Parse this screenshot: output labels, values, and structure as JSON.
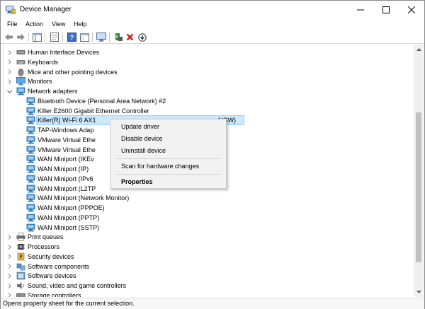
{
  "window": {
    "title": "Device Manager"
  },
  "menubar": {
    "items": [
      "File",
      "Action",
      "View",
      "Help"
    ]
  },
  "tree": {
    "items": [
      {
        "label": "Human Interface Devices",
        "icon": "hid-icon",
        "level": 1,
        "expander": "collapsed"
      },
      {
        "label": "Keyboards",
        "icon": "keyboard-icon",
        "level": 1,
        "expander": "collapsed"
      },
      {
        "label": "Mice and other pointing devices",
        "icon": "mouse-icon",
        "level": 1,
        "expander": "collapsed"
      },
      {
        "label": "Monitors",
        "icon": "monitor-icon",
        "level": 1,
        "expander": "collapsed"
      },
      {
        "label": "Network adapters",
        "icon": "network-adapter-icon",
        "level": 1,
        "expander": "expanded"
      },
      {
        "label": "Bluetooth Device (Personal Area Network) #2",
        "icon": "network-adapter-icon",
        "level": 2
      },
      {
        "label": "Killer E2600 Gigabit Ethernet Controller",
        "icon": "network-adapter-icon",
        "level": 2
      },
      {
        "label": "Killer(R) Wi-Fi 6 AX1",
        "icon": "network-adapter-icon",
        "level": 2,
        "selected": true,
        "suffix": "NGW)"
      },
      {
        "label": "TAP-Windows Adap",
        "icon": "network-adapter-icon",
        "level": 2
      },
      {
        "label": "VMware Virtual Ethe",
        "icon": "network-adapter-icon",
        "level": 2
      },
      {
        "label": "VMware Virtual Ethe",
        "icon": "network-adapter-icon",
        "level": 2
      },
      {
        "label": "WAN Miniport (IKEv",
        "icon": "network-adapter-icon",
        "level": 2
      },
      {
        "label": "WAN Miniport (IP)",
        "icon": "network-adapter-icon",
        "level": 2
      },
      {
        "label": "WAN Miniport (IPv6",
        "icon": "network-adapter-icon",
        "level": 2
      },
      {
        "label": "WAN Miniport (L2TP",
        "icon": "network-adapter-icon",
        "level": 2
      },
      {
        "label": "WAN Miniport (Network Monitor)",
        "icon": "network-adapter-icon",
        "level": 2
      },
      {
        "label": "WAN Miniport (PPPOE)",
        "icon": "network-adapter-icon",
        "level": 2
      },
      {
        "label": "WAN Miniport (PPTP)",
        "icon": "network-adapter-icon",
        "level": 2
      },
      {
        "label": "WAN Miniport (SSTP)",
        "icon": "network-adapter-icon",
        "level": 2
      },
      {
        "label": "Print queues",
        "icon": "printer-icon",
        "level": 1,
        "expander": "collapsed"
      },
      {
        "label": "Processors",
        "icon": "processor-icon",
        "level": 1,
        "expander": "collapsed"
      },
      {
        "label": "Security devices",
        "icon": "security-device-icon",
        "level": 1,
        "expander": "collapsed"
      },
      {
        "label": "Software components",
        "icon": "software-component-icon",
        "level": 1,
        "expander": "collapsed"
      },
      {
        "label": "Software devices",
        "icon": "software-device-icon",
        "level": 1,
        "expander": "collapsed"
      },
      {
        "label": "Sound, video and game controllers",
        "icon": "sound-icon",
        "level": 1,
        "expander": "collapsed"
      },
      {
        "label": "Storage controllers",
        "icon": "storage-icon",
        "level": 1,
        "expander": "collapsed"
      }
    ]
  },
  "context_menu": {
    "items": [
      {
        "label": "Update driver",
        "bold": false
      },
      {
        "label": "Disable device",
        "bold": false
      },
      {
        "label": "Uninstall device",
        "bold": false
      },
      {
        "label": "Scan for hardware changes",
        "bold": false
      },
      {
        "label": "Properties",
        "bold": true
      }
    ]
  },
  "statusbar": {
    "text": "Opens property sheet for the current selection."
  },
  "colors": {
    "selection": "#cce8ff",
    "selection_border": "#99d1ff",
    "adapter_icon": "#2b7fc9"
  }
}
